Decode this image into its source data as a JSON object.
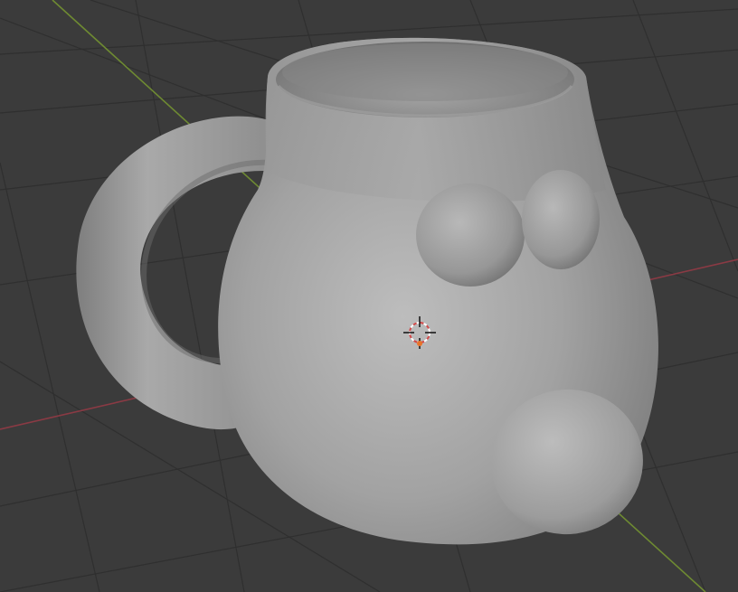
{
  "viewport": {
    "background_color": "#3b3b3b",
    "grid_color": "#2f2f2f",
    "x_axis_color": "#8a3a44",
    "y_axis_color": "#6e8a32"
  },
  "scene": {
    "object": "mug",
    "object_color": "#9c9c9c",
    "features": [
      "mug-body",
      "mug-handle",
      "left-eye-sphere",
      "right-eye-sphere",
      "nose-sphere"
    ]
  },
  "cursor": {
    "icon": "3d-cursor-icon",
    "ring_color_a": "#d24a4a",
    "ring_color_b": "#ffffff"
  }
}
